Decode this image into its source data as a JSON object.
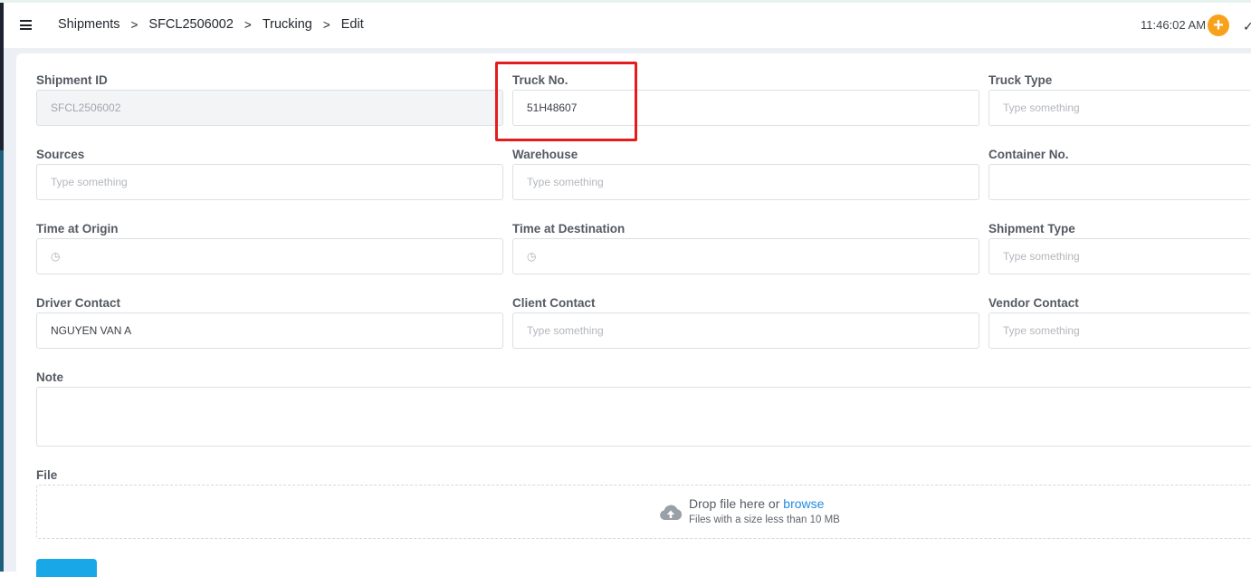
{
  "header": {
    "breadcrumb": [
      "Shipments",
      "SFCL2506002",
      "Trucking",
      "Edit"
    ],
    "separator": ">",
    "clock": "11:46:02 AM",
    "add_symbol": "+",
    "check_symbol": "✓"
  },
  "form": {
    "shipment_id": {
      "label": "Shipment ID",
      "value": "SFCL2506002"
    },
    "truck_no": {
      "label": "Truck No.",
      "value": "51H48607"
    },
    "truck_type": {
      "label": "Truck Type",
      "placeholder": "Type something"
    },
    "sources": {
      "label": "Sources",
      "placeholder": "Type something"
    },
    "warehouse": {
      "label": "Warehouse",
      "placeholder": "Type something"
    },
    "container_no": {
      "label": "Container No.",
      "value": ""
    },
    "time_origin": {
      "label": "Time at Origin",
      "icon": "clock-icon"
    },
    "time_destination": {
      "label": "Time at Destination",
      "icon": "clock-icon"
    },
    "shipment_type": {
      "label": "Shipment Type",
      "placeholder": "Type something"
    },
    "driver_contact": {
      "label": "Driver Contact",
      "value": "NGUYEN VAN A"
    },
    "client_contact": {
      "label": "Client Contact",
      "placeholder": "Type something"
    },
    "vendor_contact": {
      "label": "Vendor Contact",
      "placeholder": "Type something"
    },
    "note": {
      "label": "Note"
    },
    "file": {
      "label": "File",
      "drop_text": "Drop file here or",
      "browse": "browse",
      "hint": "Files with a size less than 10 MB"
    }
  },
  "colors": {
    "accent": "#1aa7e8",
    "add_button": "#f7a21a",
    "highlight": "#e41c1c"
  }
}
